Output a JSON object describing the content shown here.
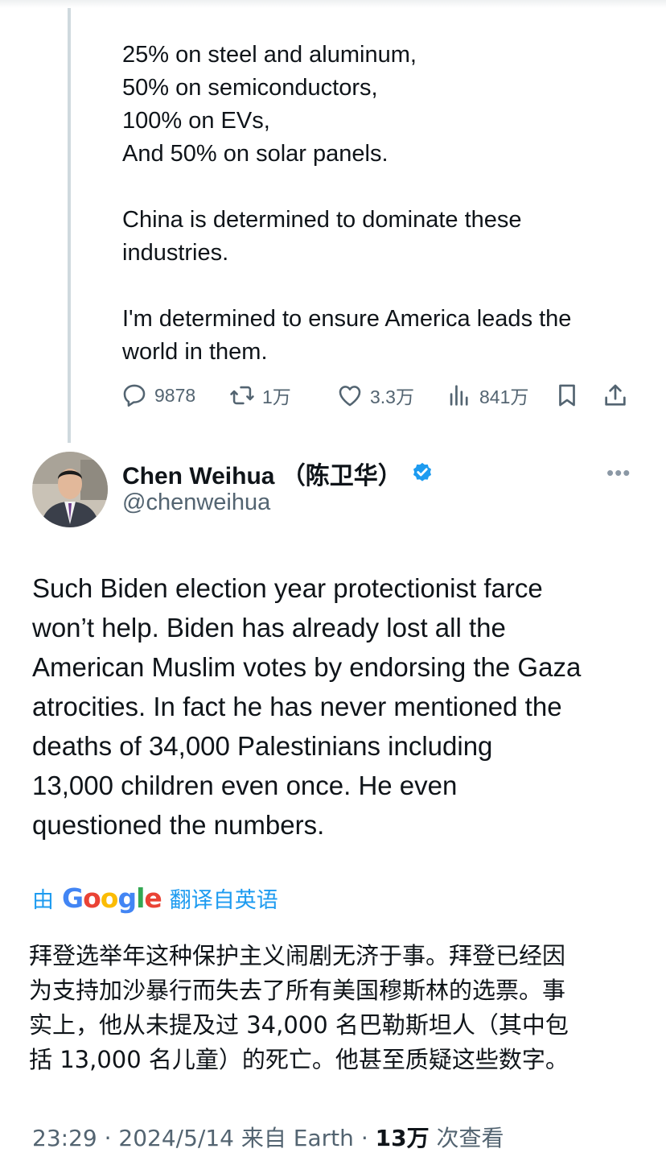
{
  "quoted_tweet": {
    "lines": [
      "25% on steel and aluminum,",
      "50% on semiconductors,",
      "100% on EVs,",
      "And 50% on solar panels.",
      "",
      "China is determined to dominate these",
      "industries.",
      "",
      "I'm determined to ensure America leads the",
      "world in them."
    ],
    "actions": {
      "replies": "9878",
      "reposts": "1万",
      "likes": "3.3万",
      "views": "841万"
    }
  },
  "reply_tweet": {
    "display_name": "Chen Weihua （陈卫华）",
    "handle": "@chenweihua",
    "verified": true,
    "verified_color": "#1d9bf0",
    "more_label": "•••",
    "body_lines": [
      "Such Biden election year protectionist farce",
      "won’t help. Biden has already lost all the",
      "American Muslim votes by endorsing the Gaza",
      "atrocities.  In fact he has never mentioned the",
      "deaths of 34,000 Palestinians including",
      "13,000 children even once. He even",
      "questioned the numbers."
    ],
    "translation_prefix": "由",
    "translation_brand": "Google",
    "translation_suffix": "翻译自英语",
    "translated_lines": [
      "拜登选举年这种保护主义闹剧无济于事。拜登已经因",
      "为支持加沙暴行而失去了所有美国穆斯林的选票。事",
      "实上，他从未提及过 34,000 名巴勒斯坦人（其中包",
      "括 13,000 名儿童）的死亡。他甚至质疑这些数字。"
    ],
    "meta": {
      "time": "23:29",
      "date": "2024/5/14",
      "source": "来自 Earth",
      "views_count": "13万",
      "views_label": "次查看"
    }
  },
  "colors": {
    "text": "#0f1419",
    "secondary": "#536471",
    "accent": "#1d9bf0",
    "thread_line": "#cfd9de"
  },
  "icons": {
    "reply": "reply-icon",
    "repost": "repost-icon",
    "like": "heart-icon",
    "views": "analytics-icon",
    "bookmark": "bookmark-icon",
    "share": "share-icon",
    "verified": "verified-badge-icon"
  }
}
